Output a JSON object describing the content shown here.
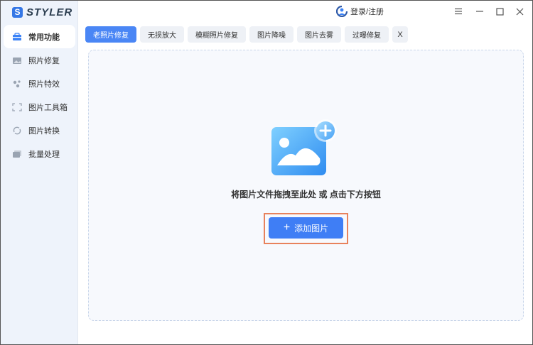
{
  "app": {
    "logo_mark": "S",
    "name": "STYLER"
  },
  "sidebar": {
    "items": [
      {
        "label": "常用功能",
        "icon": "toolbox-icon",
        "active": true
      },
      {
        "label": "照片修复",
        "icon": "photo-repair-icon"
      },
      {
        "label": "照片特效",
        "icon": "sparkle-icon"
      },
      {
        "label": "图片工具箱",
        "icon": "crop-frame-icon"
      },
      {
        "label": "图片转换",
        "icon": "convert-icon"
      },
      {
        "label": "批量处理",
        "icon": "batch-icon"
      }
    ]
  },
  "header": {
    "login_label": "登录/注册",
    "window_controls": [
      "menu-icon",
      "minimize-icon",
      "maximize-icon",
      "close-icon"
    ]
  },
  "tabs": [
    {
      "label": "老照片修复",
      "active": true
    },
    {
      "label": "无损放大"
    },
    {
      "label": "模糊照片修复"
    },
    {
      "label": "图片降噪"
    },
    {
      "label": "图片去雾"
    },
    {
      "label": "过曝修复"
    }
  ],
  "tab_close_label": "X",
  "upload": {
    "hint": "将图片文件拖拽至此处 或 点击下方按钮",
    "button_label": "添加图片",
    "button_icon": "+"
  },
  "colors": {
    "accent": "#3f7ef5",
    "highlight": "#e8825c",
    "sidebar_bg": "#eef3fb"
  }
}
